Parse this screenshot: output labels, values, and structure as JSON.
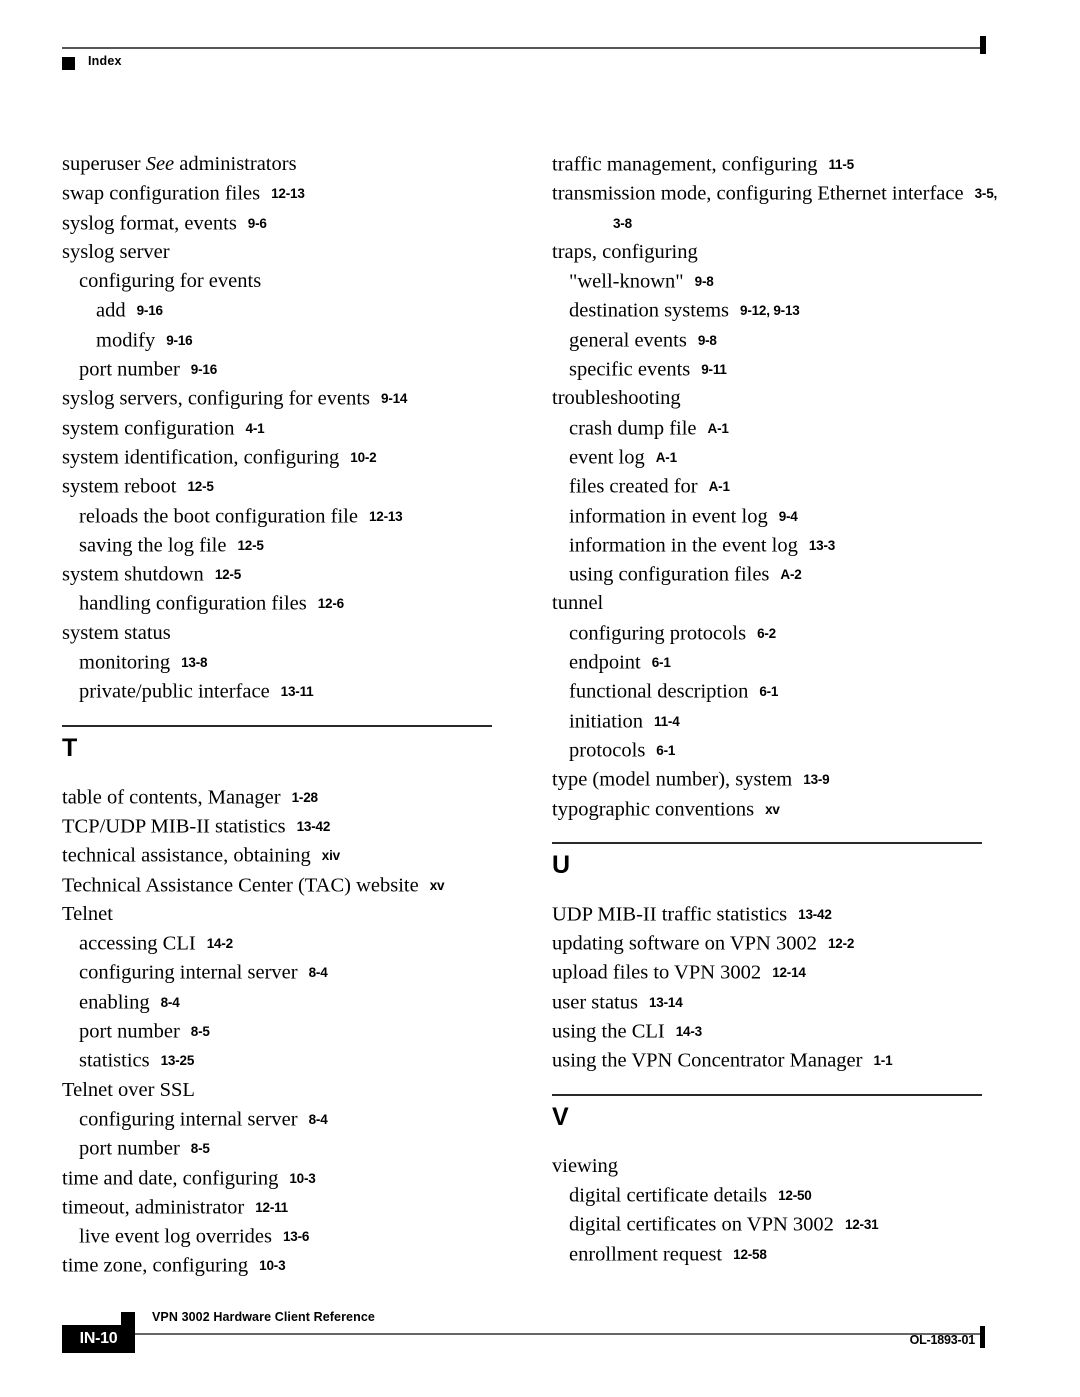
{
  "header": {
    "label": "Index"
  },
  "footer": {
    "book_title": "VPN 3002 Hardware Client Reference",
    "page_number": "IN-10",
    "doc_id": "OL-1893-01"
  },
  "left_column": {
    "entries": [
      {
        "kind": "entry",
        "level": 0,
        "text": "superuser ",
        "italic": "See",
        "text2": " administrators",
        "page": ""
      },
      {
        "kind": "entry",
        "level": 0,
        "text": "swap configuration files",
        "page": "12-13"
      },
      {
        "kind": "entry",
        "level": 0,
        "text": "syslog format, events",
        "page": "9-6"
      },
      {
        "kind": "entry",
        "level": 0,
        "text": "syslog server",
        "page": ""
      },
      {
        "kind": "entry",
        "level": 1,
        "text": "configuring for events",
        "page": ""
      },
      {
        "kind": "entry",
        "level": 2,
        "text": "add",
        "page": "9-16"
      },
      {
        "kind": "entry",
        "level": 2,
        "text": "modify",
        "page": "9-16"
      },
      {
        "kind": "entry",
        "level": 1,
        "text": "port number",
        "page": "9-16"
      },
      {
        "kind": "entry",
        "level": 0,
        "text": "syslog servers, configuring for events",
        "page": "9-14"
      },
      {
        "kind": "entry",
        "level": 0,
        "text": "system configuration",
        "page": "4-1"
      },
      {
        "kind": "entry",
        "level": 0,
        "text": "system identification, configuring",
        "page": "10-2"
      },
      {
        "kind": "entry",
        "level": 0,
        "text": "system reboot",
        "page": "12-5"
      },
      {
        "kind": "entry",
        "level": 1,
        "text": "reloads the boot configuration file",
        "page": "12-13"
      },
      {
        "kind": "entry",
        "level": 1,
        "text": "saving the log file",
        "page": "12-5"
      },
      {
        "kind": "entry",
        "level": 0,
        "text": "system shutdown",
        "page": "12-5"
      },
      {
        "kind": "entry",
        "level": 1,
        "text": "handling configuration files",
        "page": "12-6"
      },
      {
        "kind": "entry",
        "level": 0,
        "text": "system status",
        "page": ""
      },
      {
        "kind": "entry",
        "level": 1,
        "text": "monitoring",
        "page": "13-8"
      },
      {
        "kind": "entry",
        "level": 1,
        "text": "private/public interface",
        "page": "13-11"
      },
      {
        "kind": "letter",
        "letter": "T"
      },
      {
        "kind": "entry",
        "level": 0,
        "text": "table of contents, Manager",
        "page": "1-28"
      },
      {
        "kind": "entry",
        "level": 0,
        "text": "TCP/UDP MIB-II statistics",
        "page": "13-42"
      },
      {
        "kind": "entry",
        "level": 0,
        "text": "technical assistance, obtaining",
        "page": "xiv"
      },
      {
        "kind": "entry",
        "level": 0,
        "text": "Technical Assistance Center (TAC) website",
        "page": "xv"
      },
      {
        "kind": "entry",
        "level": 0,
        "text": "Telnet",
        "page": ""
      },
      {
        "kind": "entry",
        "level": 1,
        "text": "accessing CLI",
        "page": "14-2"
      },
      {
        "kind": "entry",
        "level": 1,
        "text": "configuring internal server",
        "page": "8-4"
      },
      {
        "kind": "entry",
        "level": 1,
        "text": "enabling",
        "page": "8-4"
      },
      {
        "kind": "entry",
        "level": 1,
        "text": "port number",
        "page": "8-5"
      },
      {
        "kind": "entry",
        "level": 1,
        "text": "statistics",
        "page": "13-25"
      },
      {
        "kind": "entry",
        "level": 0,
        "text": "Telnet over SSL",
        "page": ""
      },
      {
        "kind": "entry",
        "level": 1,
        "text": "configuring internal server",
        "page": "8-4"
      },
      {
        "kind": "entry",
        "level": 1,
        "text": "port number",
        "page": "8-5"
      },
      {
        "kind": "entry",
        "level": 0,
        "text": "time and date, configuring",
        "page": "10-3"
      },
      {
        "kind": "entry",
        "level": 0,
        "text": "timeout, administrator",
        "page": "12-11"
      },
      {
        "kind": "entry",
        "level": 1,
        "text": "live event log overrides",
        "page": "13-6"
      },
      {
        "kind": "entry",
        "level": 0,
        "text": "time zone, configuring",
        "page": "10-3"
      }
    ]
  },
  "right_column": {
    "entries": [
      {
        "kind": "entry",
        "level": 0,
        "text": "traffic management, configuring",
        "page": "11-5"
      },
      {
        "kind": "entry",
        "level": 0,
        "text": "transmission mode, configuring Ethernet interface",
        "page": "3-5,"
      },
      {
        "kind": "entry",
        "level": 3,
        "text": "",
        "page": "3-8"
      },
      {
        "kind": "entry",
        "level": 0,
        "text": "traps, configuring",
        "page": ""
      },
      {
        "kind": "entry",
        "level": 1,
        "text": "\"well-known\"",
        "page": "9-8"
      },
      {
        "kind": "entry",
        "level": 1,
        "text": "destination systems",
        "page": "9-12, 9-13"
      },
      {
        "kind": "entry",
        "level": 1,
        "text": "general events",
        "page": "9-8"
      },
      {
        "kind": "entry",
        "level": 1,
        "text": "specific events",
        "page": "9-11"
      },
      {
        "kind": "entry",
        "level": 0,
        "text": "troubleshooting",
        "page": ""
      },
      {
        "kind": "entry",
        "level": 1,
        "text": "crash dump file",
        "page": "A-1"
      },
      {
        "kind": "entry",
        "level": 1,
        "text": "event log",
        "page": "A-1"
      },
      {
        "kind": "entry",
        "level": 1,
        "text": "files created for",
        "page": "A-1"
      },
      {
        "kind": "entry",
        "level": 1,
        "text": "information in event log",
        "page": "9-4"
      },
      {
        "kind": "entry",
        "level": 1,
        "text": "information in the event log",
        "page": "13-3"
      },
      {
        "kind": "entry",
        "level": 1,
        "text": "using configuration files",
        "page": "A-2"
      },
      {
        "kind": "entry",
        "level": 0,
        "text": "tunnel",
        "page": ""
      },
      {
        "kind": "entry",
        "level": 1,
        "text": "configuring protocols",
        "page": "6-2"
      },
      {
        "kind": "entry",
        "level": 1,
        "text": "endpoint",
        "page": "6-1"
      },
      {
        "kind": "entry",
        "level": 1,
        "text": "functional description",
        "page": "6-1"
      },
      {
        "kind": "entry",
        "level": 1,
        "text": "initiation",
        "page": "11-4"
      },
      {
        "kind": "entry",
        "level": 1,
        "text": "protocols",
        "page": "6-1"
      },
      {
        "kind": "entry",
        "level": 0,
        "text": "type (model number), system",
        "page": "13-9"
      },
      {
        "kind": "entry",
        "level": 0,
        "text": "typographic conventions",
        "page": "xv"
      },
      {
        "kind": "letter",
        "letter": "U"
      },
      {
        "kind": "entry",
        "level": 0,
        "text": "UDP MIB-II traffic statistics",
        "page": "13-42"
      },
      {
        "kind": "entry",
        "level": 0,
        "text": "updating software on VPN 3002",
        "page": "12-2"
      },
      {
        "kind": "entry",
        "level": 0,
        "text": "upload files to VPN 3002",
        "page": "12-14"
      },
      {
        "kind": "entry",
        "level": 0,
        "text": "user status",
        "page": "13-14"
      },
      {
        "kind": "entry",
        "level": 0,
        "text": "using the CLI",
        "page": "14-3"
      },
      {
        "kind": "entry",
        "level": 0,
        "text": "using the VPN Concentrator Manager",
        "page": "1-1"
      },
      {
        "kind": "letter",
        "letter": "V"
      },
      {
        "kind": "entry",
        "level": 0,
        "text": "viewing",
        "page": ""
      },
      {
        "kind": "entry",
        "level": 1,
        "text": "digital certificate details",
        "page": "12-50"
      },
      {
        "kind": "entry",
        "level": 1,
        "text": "digital certificates on VPN 3002",
        "page": "12-31"
      },
      {
        "kind": "entry",
        "level": 1,
        "text": "enrollment request",
        "page": "12-58"
      }
    ]
  }
}
